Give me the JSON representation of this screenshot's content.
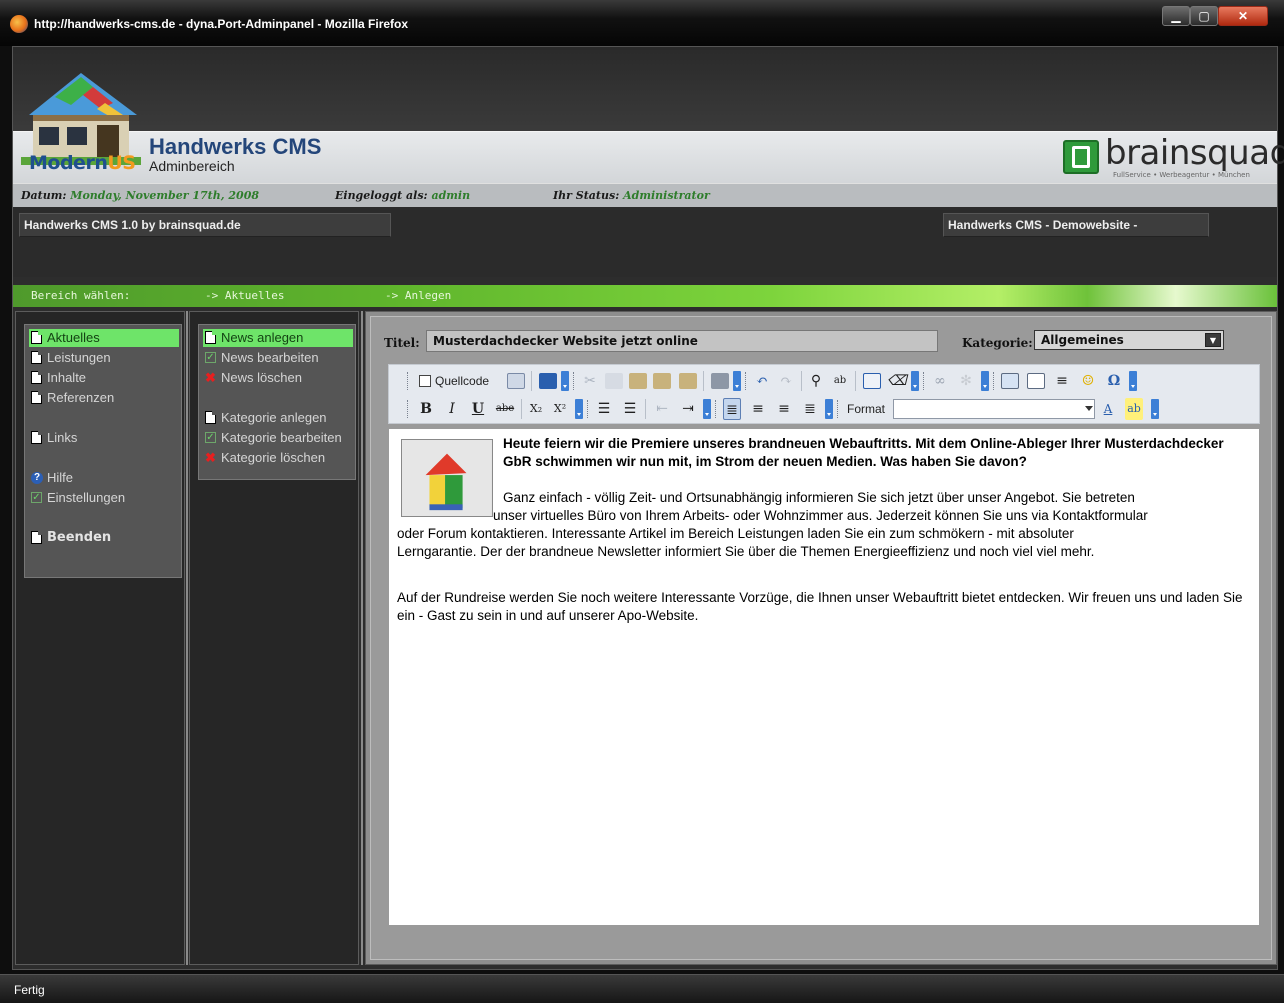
{
  "window": {
    "title": "http://handwerks-cms.de - dyna.Port-Adminpanel - Mozilla Firefox",
    "status": "Fertig"
  },
  "header": {
    "brand_left_a": "Modern",
    "brand_left_b": "US",
    "cms_title": "Handwerks CMS",
    "cms_subtitle": "Adminbereich",
    "brand_right": "brainsquad",
    "brand_right_tag": "FullService • Werbeagentur • München"
  },
  "infobar": {
    "date_label": "Datum:",
    "date_value": "Monday, November 17th, 2008",
    "user_label": "Eingeloggt als:",
    "user_value": "admin",
    "status_label": "Ihr Status:",
    "status_value": "Administrator"
  },
  "tabs": {
    "left": "Handwerks CMS 1.0 by brainsquad.de",
    "right": "Handwerks CMS - Demowebsite -"
  },
  "nav": {
    "area": "Bereich wählen:",
    "section": "-> Aktuelles",
    "action": "-> Anlegen"
  },
  "sidebar": {
    "items": [
      {
        "label": "Aktuelles",
        "icon": "document-icon"
      },
      {
        "label": "Leistungen",
        "icon": "document-icon"
      },
      {
        "label": "Inhalte",
        "icon": "document-icon"
      },
      {
        "label": "Referenzen",
        "icon": "document-icon"
      },
      {
        "label": "Links",
        "icon": "document-icon"
      },
      {
        "label": "Hilfe",
        "icon": "help-icon"
      },
      {
        "label": "Einstellungen",
        "icon": "checkbox-icon"
      },
      {
        "label": "Beenden",
        "icon": "document-icon"
      }
    ]
  },
  "submenu": {
    "items": [
      {
        "label": "News anlegen",
        "icon": "document-icon"
      },
      {
        "label": "News bearbeiten",
        "icon": "checkbox-icon"
      },
      {
        "label": "News löschen",
        "icon": "delete-icon"
      },
      {
        "label": "Kategorie anlegen",
        "icon": "document-icon"
      },
      {
        "label": "Kategorie bearbeiten",
        "icon": "checkbox-icon"
      },
      {
        "label": "Kategorie löschen",
        "icon": "delete-icon"
      }
    ]
  },
  "form": {
    "title_label": "Titel:",
    "title_value": "Musterdachdecker Website jetzt online",
    "category_label": "Kategorie:",
    "category_value": "Allgemeines"
  },
  "toolbar": {
    "source_label": "Quellcode",
    "format_label": "Format",
    "format_value": "",
    "bold": "B",
    "italic": "I",
    "underline": "U",
    "strike": "abe",
    "subscript": "X₂",
    "superscript": "X²",
    "special_char": "Ω"
  },
  "article": {
    "headline": "Heute feiern wir die Premiere unseres brandneuen Webauftritts. Mit dem Online-Ableger Ihrer Musterdachdecker GbR schwimmen wir nun mit, im Strom der neuen Medien. Was haben Sie davon?",
    "p1_l1": "Ganz einfach - völlig Zeit- und Ortsunabhängig informieren Sie sich jetzt über unser Angebot. Sie betreten",
    "p1_l2": "unser virtuelles Büro von Ihrem Arbeits- oder Wohnzimmer aus. Jederzeit können Sie uns via Kontaktformular",
    "p1_l3": "oder Forum kontaktieren. Interessante Artikel im Bereich Leistungen laden Sie ein zum schmökern - mit absoluter",
    "p1_l4": "Lerngarantie. Der der brandneue Newsletter informiert Sie über die Themen Energieeffizienz und noch viel viel mehr.",
    "p2": "Auf der Rundreise werden Sie noch weitere Interessante Vorzüge, die Ihnen unser Webauftritt bietet entdecken. Wir freuen uns und laden Sie ein - Gast zu sein in und auf unserer Apo-Website."
  },
  "colors": {
    "accent_green": "#6ee469",
    "info_value_green": "#2e7d2b",
    "brand_blue": "#24467a",
    "brand_orange": "#f39a1e"
  }
}
